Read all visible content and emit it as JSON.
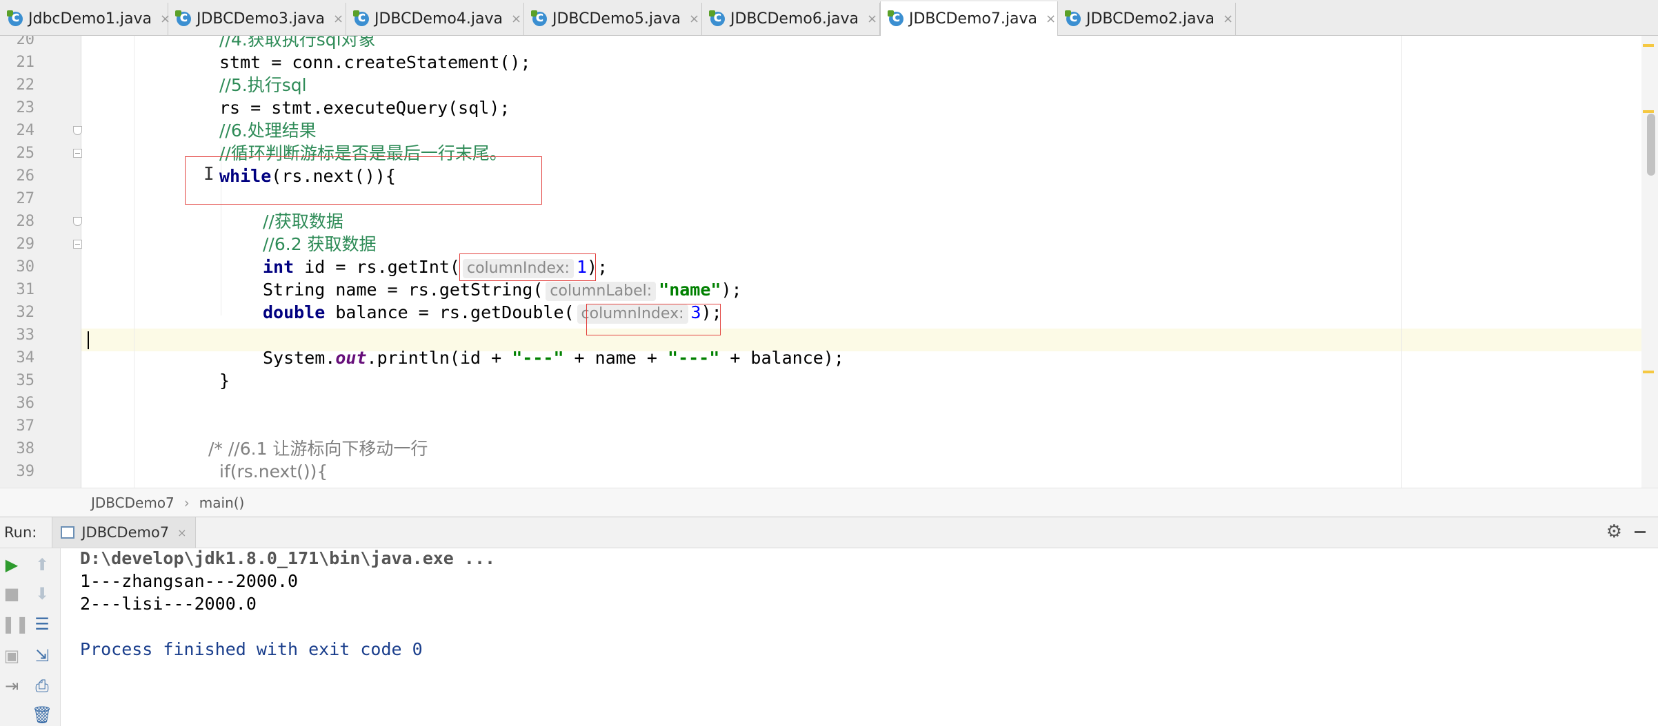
{
  "tabs": [
    {
      "label": "JdbcDemo1.java",
      "active": false
    },
    {
      "label": "JDBCDemo3.java",
      "active": false
    },
    {
      "label": "JDBCDemo4.java",
      "active": false
    },
    {
      "label": "JDBCDemo5.java",
      "active": false
    },
    {
      "label": "JDBCDemo6.java",
      "active": false
    },
    {
      "label": "JDBCDemo7.java",
      "active": true
    },
    {
      "label": "JDBCDemo2.java",
      "active": false
    }
  ],
  "tab_close_glyph": "×",
  "editor": {
    "line_numbers": [
      "20",
      "21",
      "22",
      "23",
      "24",
      "25",
      "26",
      "27",
      "28",
      "29",
      "30",
      "31",
      "32",
      "33",
      "34",
      "35",
      "36",
      "37",
      "38",
      "39"
    ],
    "current_line": "33",
    "code": {
      "l20": "//4.获取执行sql对象",
      "l21": "stmt = conn.createStatement();",
      "l22": "//5.执行sql",
      "l23": "rs = stmt.executeQuery(sql);",
      "l24": "//6.处理结果",
      "l25": "//循环判断游标是否是最后一行末尾。",
      "l26_kw": "while",
      "l26_rest": "(rs.next()){",
      "l28": "//获取数据",
      "l29": "//6.2 获取数据",
      "l30_kw": "int",
      "l30_a": " id = rs.getInt(",
      "l30_hint": "columnIndex:",
      "l30_num": "1",
      "l30_end": ");",
      "l31_a": "String name = rs.getString(",
      "l31_hint": "columnLabel:",
      "l31_str": "\"name\"",
      "l31_end": ");",
      "l32_kw": "double",
      "l32_a": " balance = rs.getDouble(",
      "l32_hint": "columnIndex:",
      "l32_num": "3",
      "l32_end": ");",
      "l34_a": "System.",
      "l34_field": "out",
      "l34_b": ".println(id + ",
      "l34_s1": "\"---\"",
      "l34_c": " + name + ",
      "l34_s2": "\"---\"",
      "l34_d": " + balance);",
      "l35": "}",
      "l38": "/* //6.1 让游标向下移动一行",
      "l39": "if(rs.next()){"
    }
  },
  "breadcrumb": {
    "class": "JDBCDemo7",
    "separator": "›",
    "method": "main()"
  },
  "run_panel": {
    "label": "Run:",
    "tab": "JDBCDemo7",
    "console": [
      "D:\\develop\\jdk1.8.0_171\\bin\\java.exe ...",
      "1---zhangsan---2000.0",
      "2---lisi---2000.0",
      "Process finished with exit code 0"
    ]
  },
  "icons": {
    "run": "run-icon",
    "stop": "stop-icon",
    "pause": "pause-icon",
    "up": "up-arrow-icon",
    "down": "down-arrow-icon",
    "settings": "gear-icon"
  }
}
